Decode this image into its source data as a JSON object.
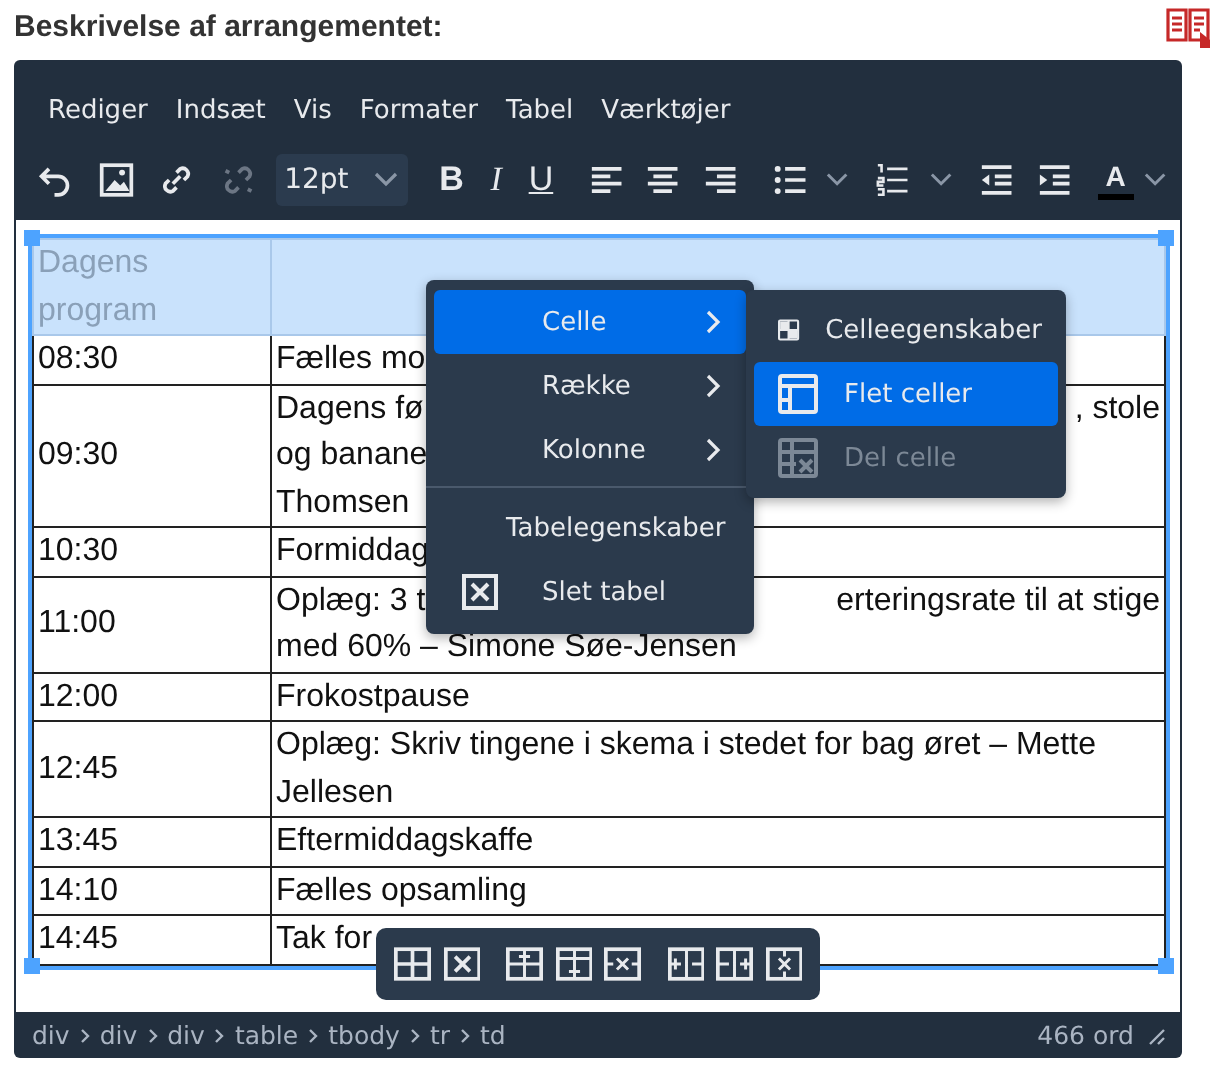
{
  "field_label": "Beskrivelse af arrangementet:",
  "menubar": [
    "Rediger",
    "Indsæt",
    "Vis",
    "Formater",
    "Tabel",
    "Værktøjer"
  ],
  "toolbar": {
    "font_size": "12pt",
    "format_buttons": [
      "B",
      "I",
      "U"
    ],
    "unlink_disabled": true,
    "text_color_label": "A"
  },
  "table": {
    "header": {
      "lines": [
        "Dagens",
        "program"
      ],
      "selected": true
    },
    "rows": [
      {
        "time": "08:30",
        "lines": [
          [
            "Fælles mo"
          ]
        ],
        "selected": false
      },
      {
        "time": "09:30",
        "lines": [
          [
            "Dagens fø",
            ", stole"
          ],
          [
            "og banane"
          ],
          [
            "Thomsen"
          ]
        ],
        "selected": false
      },
      {
        "time": "10:30",
        "lines": [
          [
            "Formiddag"
          ]
        ],
        "selected": false
      },
      {
        "time": "11:00",
        "lines": [
          [
            "Oplæg: 3 t",
            "erteringsrate til at stige"
          ],
          [
            "med 60% – Simone Søe-Jensen"
          ]
        ],
        "selected": false
      },
      {
        "time": "12:00",
        "lines": [
          [
            "Frokostpause"
          ]
        ],
        "selected": false
      },
      {
        "time": "12:45",
        "lines": [
          [
            "Oplæg: Skriv tingene i skema i stedet for bag øret – Mette"
          ],
          [
            "Jellesen"
          ]
        ],
        "selected": false
      },
      {
        "time": "13:45",
        "lines": [
          [
            "Eftermiddagskaffe"
          ]
        ],
        "selected": false
      },
      {
        "time": "14:10",
        "lines": [
          [
            "Fælles opsamling"
          ]
        ],
        "selected": false
      },
      {
        "time": "14:45",
        "lines": [
          [
            "Tak for"
          ]
        ],
        "selected": false
      }
    ]
  },
  "context_menu": {
    "items": [
      {
        "label": "Celle",
        "kind": "submenu",
        "highlighted": true
      },
      {
        "label": "Række",
        "kind": "submenu",
        "highlighted": false
      },
      {
        "label": "Kolonne",
        "kind": "submenu",
        "highlighted": false
      },
      {
        "label": "Tabelegenskaber",
        "kind": "plain",
        "highlighted": false
      },
      {
        "label": "Slet tabel",
        "kind": "delete",
        "highlighted": false
      }
    ]
  },
  "submenu": {
    "items": [
      {
        "label": "Celleegenskaber",
        "highlighted": false,
        "disabled": false
      },
      {
        "label": "Flet celler",
        "highlighted": true,
        "disabled": false
      },
      {
        "label": "Del celle",
        "highlighted": false,
        "disabled": true
      }
    ]
  },
  "status_bar": {
    "path": [
      "div",
      "div",
      "div",
      "table",
      "tbody",
      "tr",
      "td"
    ],
    "word_count": "466 ord"
  }
}
